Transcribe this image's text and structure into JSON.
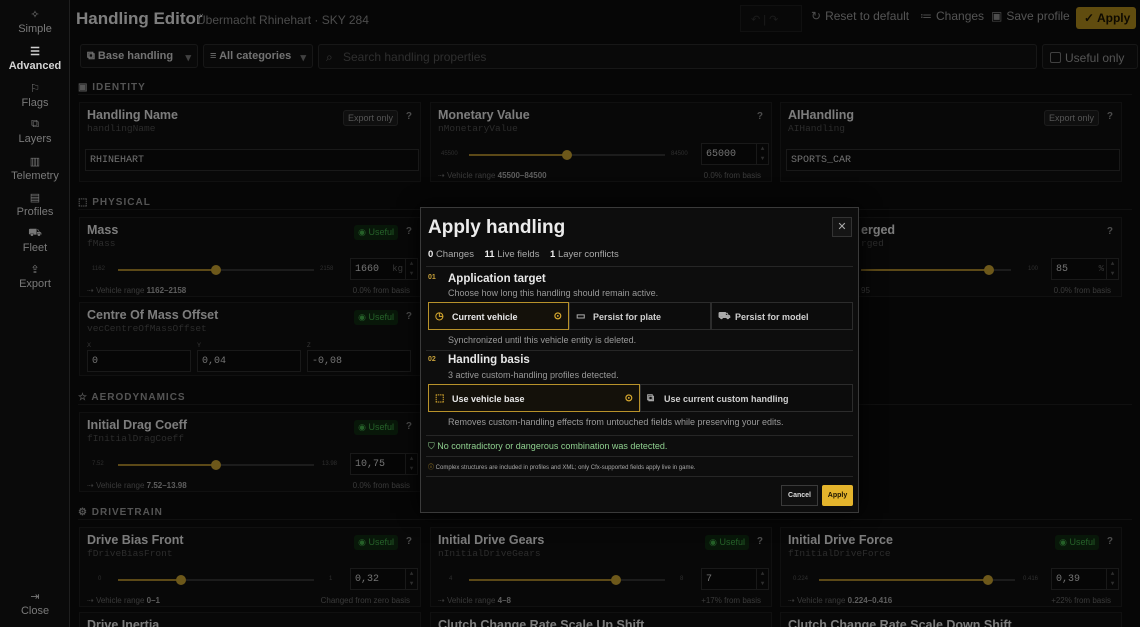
{
  "sidebar": {
    "items": [
      {
        "label": "Simple",
        "icon": "sparkle-icon"
      },
      {
        "label": "Advanced",
        "icon": "sliders-icon"
      },
      {
        "label": "Flags",
        "icon": "flag-icon"
      },
      {
        "label": "Layers",
        "icon": "layers-icon"
      },
      {
        "label": "Telemetry",
        "icon": "chart-icon"
      },
      {
        "label": "Profiles",
        "icon": "file-icon"
      },
      {
        "label": "Fleet",
        "icon": "car-icon"
      },
      {
        "label": "Export",
        "icon": "export-icon"
      }
    ],
    "active": "Advanced",
    "close_label": "Close"
  },
  "header": {
    "title": "Handling Editor",
    "subtitle": "Übermacht Rhinehart · SKY 284",
    "reset_label": "Reset to default",
    "changes_label": "Changes",
    "save_label": "Save profile",
    "apply_label": "Apply"
  },
  "filters": {
    "base": "Base handling",
    "category": "All categories",
    "search_placeholder": "Search handling properties",
    "useful_only": "Useful only"
  },
  "sections": {
    "identity": "IDENTITY",
    "physical": "PHYSICAL",
    "aerodynamics": "AERODYNAMICS",
    "drivetrain": "DRIVETRAIN"
  },
  "cards": {
    "handling_name": {
      "title": "Handling Name",
      "code": "handlingName",
      "badge": "Export only",
      "value": "RHINEHART"
    },
    "monetary": {
      "title": "Monetary Value",
      "code": "nMonetaryValue",
      "min": "45500",
      "max": "84500",
      "value": "65000",
      "range_label": "Vehicle range",
      "range": "45500–84500",
      "basis": "0.0% from basis",
      "pos": 0.5
    },
    "aihandling": {
      "title": "AIHandling",
      "code": "AIHandling",
      "badge": "Export only",
      "value": "SPORTS_CAR"
    },
    "mass": {
      "title": "Mass",
      "code": "fMass",
      "badge": "Useful",
      "min": "1162",
      "max": "2158",
      "value": "1660",
      "unit": "kg",
      "range_label": "Vehicle range",
      "range": "1162–2158",
      "basis": "0.0% from basis",
      "pos": 0.5
    },
    "percent_submerged": {
      "title": "erged",
      "code": "rged",
      "min": "",
      "max": "100",
      "value": "85",
      "unit": "%",
      "range": "95",
      "basis": "0.0% from basis",
      "pos": 0.85
    },
    "com_offset": {
      "title": "Centre Of Mass Offset",
      "code": "vecCentreOfMassOffset",
      "badge": "Useful",
      "labels": [
        "X",
        "Y",
        "Z"
      ],
      "values": [
        "0",
        "0,04",
        "-0,08"
      ]
    },
    "drag": {
      "title": "Initial Drag Coeff",
      "code": "fInitialDragCoeff",
      "badge": "Useful",
      "min": "7.52",
      "max": "13.98",
      "value": "10,75",
      "range_label": "Vehicle range",
      "range": "7.52–13.98",
      "basis": "0.0% from basis",
      "pos": 0.5
    },
    "bias_front": {
      "title": "Drive Bias Front",
      "code": "fDriveBiasFront",
      "badge": "Useful",
      "min": "0",
      "max": "1",
      "value": "0,32",
      "range_label": "Vehicle range",
      "range": "0–1",
      "basis": "Changed from zero basis",
      "pos": 0.32
    },
    "drive_gears": {
      "title": "Initial Drive Gears",
      "code": "nInitialDriveGears",
      "badge": "Useful",
      "min": "4",
      "max": "8",
      "value": "7",
      "range_label": "Vehicle range",
      "range": "4–8",
      "basis": "+17% from basis",
      "pos": 0.75
    },
    "drive_force": {
      "title": "Initial Drive Force",
      "code": "fInitialDriveForce",
      "badge": "Useful",
      "min": "0.224",
      "max": "0.416",
      "value": "0,39",
      "range_label": "Vehicle range",
      "range": "0.224–0.416",
      "basis": "+22% from basis",
      "pos": 0.86
    },
    "inertia": {
      "title": "Drive Inertia"
    },
    "clutch_up": {
      "title": "Clutch Change Rate Scale Up Shift"
    },
    "clutch_down": {
      "title": "Clutch Change Rate Scale Down Shift"
    }
  },
  "modal": {
    "title": "Apply handling",
    "stats": {
      "changes_n": "0",
      "changes_l": "Changes",
      "live_n": "11",
      "live_l": "Live fields",
      "conf_n": "1",
      "conf_l": "Layer conflicts"
    },
    "step1": {
      "num": "01",
      "title": "Application target",
      "desc": "Choose how long this handling should remain active.",
      "options": [
        "Current vehicle",
        "Persist for plate",
        "Persist for model"
      ],
      "note": "Synchronized until this vehicle entity is deleted."
    },
    "step2": {
      "num": "02",
      "title": "Handling basis",
      "desc": "3 active custom-handling profiles detected.",
      "options": [
        "Use vehicle base",
        "Use current custom handling"
      ],
      "note": "Removes custom-handling effects from untouched fields while preserving your edits."
    },
    "ok": "No contradictory or dangerous combination was detected.",
    "info": "Complex structures are included in profiles and XML; only Cfx-supported fields apply live in game.",
    "cancel": "Cancel",
    "apply": "Apply"
  }
}
